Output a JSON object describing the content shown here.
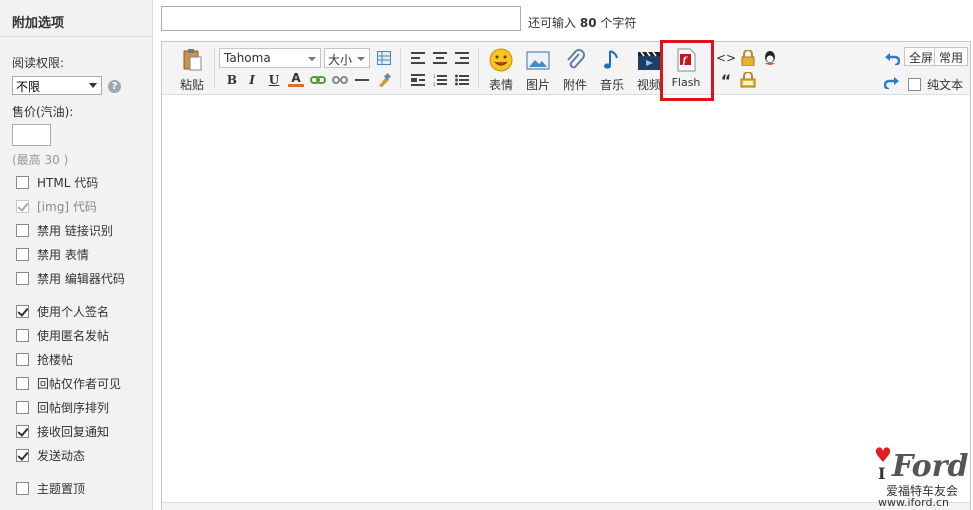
{
  "sidebar": {
    "title": "附加选项",
    "read_perm_label": "阅读权限:",
    "read_perm_value": "不限",
    "price_label": "售价(汽油):",
    "price_hint": "(最高 30 )",
    "options_a": [
      {
        "label": "HTML 代码",
        "checked": false,
        "disabled": false
      },
      {
        "label": "[img] 代码",
        "checked": true,
        "disabled": true
      },
      {
        "label": "禁用  链接识别",
        "checked": false,
        "disabled": false
      },
      {
        "label": "禁用  表情",
        "checked": false,
        "disabled": false
      },
      {
        "label": "禁用  编辑器代码",
        "checked": false,
        "disabled": false
      }
    ],
    "options_b": [
      {
        "label": "使用个人签名",
        "checked": true
      },
      {
        "label": "使用匿名发帖",
        "checked": false
      },
      {
        "label": "抢楼帖",
        "checked": false
      },
      {
        "label": "回帖仅作者可见",
        "checked": false
      },
      {
        "label": "回帖倒序排列",
        "checked": false
      },
      {
        "label": "接收回复通知",
        "checked": true
      },
      {
        "label": "发送动态",
        "checked": true
      }
    ],
    "options_c": [
      {
        "label": "主题置顶",
        "checked": false
      }
    ]
  },
  "title_bar": {
    "counter_prefix": "还可输入",
    "counter_value": "80",
    "counter_suffix": "个字符"
  },
  "toolbar": {
    "paste_label": "粘贴",
    "font_value": "Tahoma",
    "size_value": "大小",
    "emoji_label": "表情",
    "image_label": "图片",
    "attach_label": "附件",
    "music_label": "音乐",
    "video_label": "视频",
    "flash_label": "Flash",
    "fullscreen_label": "全屏",
    "common_label": "常用",
    "plain_text_label": "纯文本",
    "bold_glyph": "B",
    "italic_glyph": "I",
    "underline_glyph": "U",
    "color_glyph": "A",
    "code_glyph": "<>",
    "quote_glyph": "“"
  },
  "watermark": {
    "brand_i": "I",
    "brand": "Ford",
    "cn": "爱福特车友会",
    "url": "www.iford.cn"
  },
  "colors": {
    "highlight": "#d9141b",
    "sidebar_bg": "#f2f2f2",
    "toolbar_bg": "#f4f4f4"
  }
}
